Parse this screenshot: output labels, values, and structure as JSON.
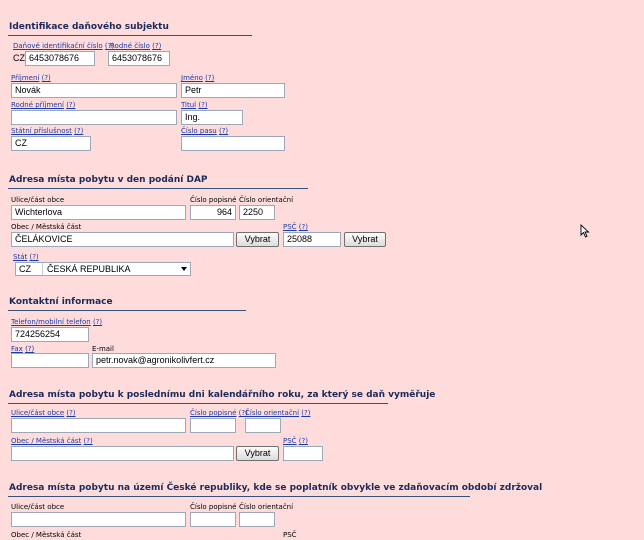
{
  "sections": {
    "s1": "Identifikace daňového subjektu",
    "s2": "Adresa místa pobytu v den podání DAP",
    "s3": "Kontaktní informace",
    "s4": "Adresa místa pobytu k poslednímu dni kalendářního roku, za který se daň vyměřuje",
    "s5": "Adresa místa pobytu na území České republiky, kde se poplatník obvykle ve zdaňovacím období zdržoval"
  },
  "help": "(?)",
  "identification": {
    "dic_label": "Daňové identifikační číslo",
    "dic_prefix": "CZ",
    "dic_value": "6453078676",
    "rc_label": "Rodné číslo",
    "rc_value": "6453078676",
    "surname_label": "Příjmení",
    "surname_value": "Novák",
    "name_label": "Jméno",
    "name_value": "Petr",
    "birth_surname_label": "Rodné příjmení",
    "birth_surname_value": "",
    "title_label": "Titul",
    "title_value": "Ing.",
    "citizenship_label": "Státní příslušnost",
    "citizenship_value": "CZ",
    "passport_label": "Číslo pasu",
    "passport_value": ""
  },
  "address1": {
    "street_label": "Ulice/část obce",
    "street_value": "Wichterlova",
    "cp_label": "Číslo popisné",
    "cp_value": "964",
    "co_label": "Číslo orientační",
    "co_value": "2250",
    "city_label": "Obec / Městská část",
    "city_value": "ČELÁKOVICE",
    "choose_button": "Vybrat",
    "psc_label": "PSČ",
    "psc_value": "25088",
    "choose_button_2": "Vybrat",
    "state_label": "Stát",
    "state_code": "CZ",
    "state_name": "ČESKÁ REPUBLIKA"
  },
  "contact": {
    "phone_label": "Telefon/mobilní telefon",
    "phone_value": "724256254",
    "fax_label": "Fax",
    "fax_value": "",
    "email_label": "E-mail",
    "email_value": "petr.novak@agronikolivfert.cz"
  },
  "address2": {
    "street_label": "Ulice/část obce",
    "cp_label": "Číslo popisné",
    "co_label": "Číslo orientační",
    "city_label": "Obec / Městská část",
    "choose_button": "Vybrat",
    "psc_label": "PSČ"
  },
  "address3": {
    "street_label": "Ulice/část obce",
    "cp_label": "Číslo popisné",
    "co_label": "Číslo orientační",
    "city_label": "Obec / Městská část",
    "psc_label": "PSČ"
  }
}
